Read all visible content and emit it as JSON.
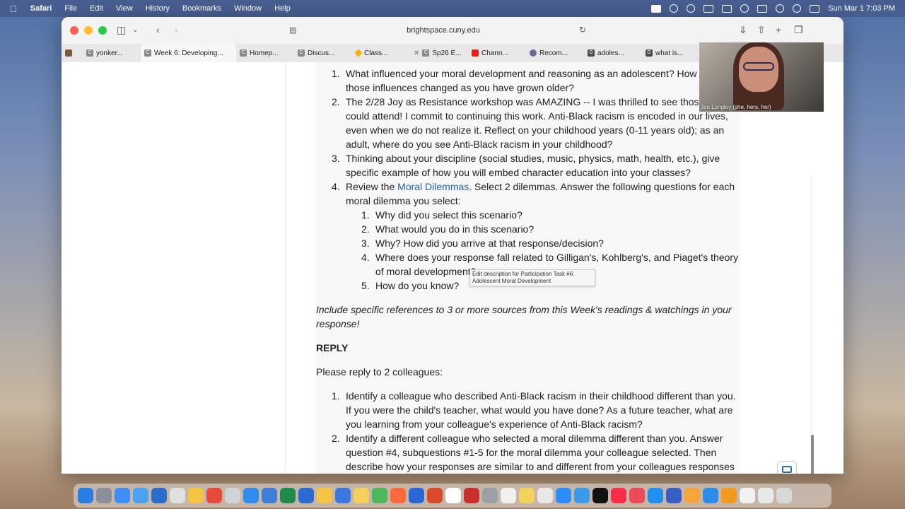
{
  "menubar": {
    "app": "Safari",
    "menus": [
      "File",
      "Edit",
      "View",
      "History",
      "Bookmarks",
      "Window",
      "Help"
    ],
    "datetime": "Sun Mar 1  7:03 PM"
  },
  "browser": {
    "url": "brightspace.cuny.edu",
    "tabs": [
      {
        "label": "yonker...",
        "favicon": "C",
        "active": false
      },
      {
        "label": "Week 6: Developing...",
        "favicon": "C",
        "active": true
      },
      {
        "label": "Homep...",
        "favicon": "C",
        "active": false
      },
      {
        "label": "Discus...",
        "favicon": "C",
        "active": false
      },
      {
        "label": "Class...",
        "favicon": "drive",
        "active": false
      },
      {
        "label": "Sp26 E...",
        "favicon": "C",
        "active": false,
        "closable": true
      },
      {
        "label": "Chann...",
        "favicon": "youtube",
        "active": false
      },
      {
        "label": "Recom...",
        "favicon": "circle",
        "active": false
      },
      {
        "label": "adoles...",
        "favicon": "G",
        "active": false
      },
      {
        "label": "what is...",
        "favicon": "G",
        "active": false
      }
    ]
  },
  "content": {
    "questions": [
      {
        "num": "1.",
        "text": "What influenced your moral development and reasoning as an adolescent? How have those influences changed as you have grown older?"
      },
      {
        "num": "2.",
        "text": "The 2/28 Joy as Resistance workshop was AMAZING -- I was thrilled to see those who could attend! I commit to continuing this work. Anti-Black racism is encoded in our lives, even when we do not realize it. Reflect on your childhood years (0-11 years old); as an adult, where do you see Anti-Black racism in your childhood?"
      },
      {
        "num": "3.",
        "text": "Thinking about your discipline (social studies, music, physics, math, health, etc.), give specific example of how you will embed character education into your classes?"
      }
    ],
    "q4": {
      "num": "4.",
      "pre": "Review the ",
      "link": "Moral Dilemmas",
      "post": ". Select 2 dilemmas. Answer the following questions for each moral dilemma you select:"
    },
    "subquestions": [
      {
        "num": "1.",
        "text": "Why did you select this scenario?"
      },
      {
        "num": "2.",
        "text": "What would you do in this scenario?"
      },
      {
        "num": "3.",
        "text": "Why? How did you arrive at that response/decision?"
      },
      {
        "num": "4.",
        "text": "Where does your response fall related to Gilligan's,  Kohlberg's, and Piaget's theory of moral development?"
      },
      {
        "num": "5.",
        "text": "How do you know?"
      }
    ],
    "references_note": "Include specific references to 3 or more sources from this Week's readings & watchings in your response!",
    "reply_heading": "REPLY",
    "reply_intro": "Please reply to 2 colleagues:",
    "reply_items": [
      {
        "num": "1.",
        "text": "Identify a colleague who described Anti-Black racism in their childhood different than you. If you were the child's teacher, what would you have done? As a future teacher, what are you learning from your colleague's experience of Anti-Black racism?"
      },
      {
        "num": "2.",
        "text": "Identify a different colleague who selected a moral dilemma different than you. Answer question #4, subquestions #1-5 for the moral dilemma your colleague selected. Then describe how your responses are similar to and different from your colleagues responses"
      }
    ],
    "tooltip": "Edit description for Participation Task #6: Adolescent Moral Development"
  },
  "webcam": {
    "caption": "Jen Longley (she, hers, her)"
  },
  "colors": {
    "link": "#1f5ea8",
    "close": "#ff5f57",
    "minimize": "#febc2e",
    "zoom": "#28c840"
  }
}
